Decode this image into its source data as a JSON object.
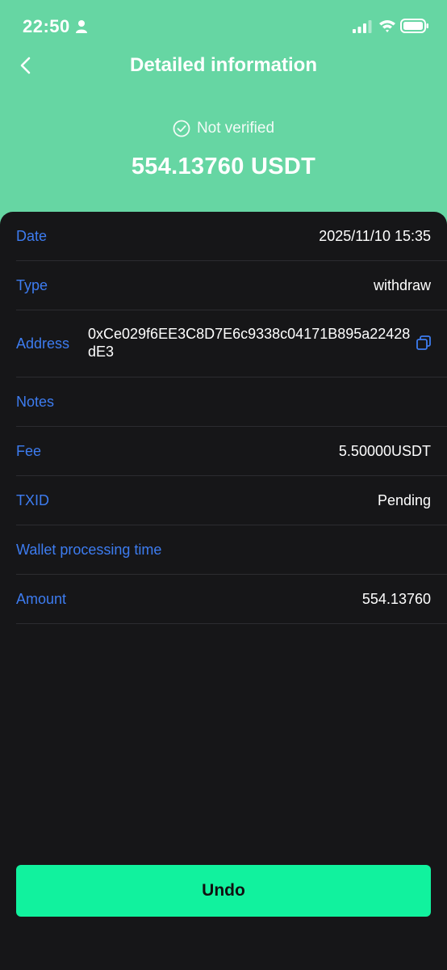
{
  "status_bar": {
    "time": "22:50"
  },
  "header": {
    "title": "Detailed information"
  },
  "summary": {
    "status": "Not verified",
    "amount": "554.13760 USDT"
  },
  "details": {
    "date": {
      "label": "Date",
      "value": "2025/11/10 15:35"
    },
    "type": {
      "label": "Type",
      "value": "withdraw"
    },
    "address": {
      "label": "Address",
      "value": "0xCe029f6EE3C8D7E6c9338c04171B895a22428dE3"
    },
    "notes": {
      "label": "Notes",
      "value": ""
    },
    "fee": {
      "label": "Fee",
      "value": "5.50000USDT"
    },
    "txid": {
      "label": "TXID",
      "value": "Pending"
    },
    "processing": {
      "label": "Wallet processing time",
      "value": ""
    },
    "amount": {
      "label": "Amount",
      "value": "554.13760"
    }
  },
  "actions": {
    "undo_label": "Undo"
  },
  "colors": {
    "header_bg": "#66d6a3",
    "sheet_bg": "#161618",
    "label": "#3d7cf0",
    "button": "#11f29e"
  }
}
